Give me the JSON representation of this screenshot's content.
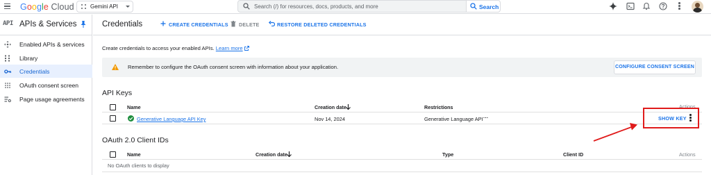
{
  "topbar": {
    "logo_parts": [
      "G",
      "o",
      "o",
      "g",
      "l",
      "e"
    ],
    "logo_cloud": "Cloud",
    "project": "Gemini API",
    "search_placeholder": "Search (/) for resources, docs, products, and more",
    "search_button": "Search",
    "icons": [
      "gemini-spark-icon",
      "cloud-shell-icon",
      "notifications-icon",
      "help-icon",
      "more-vert-icon"
    ]
  },
  "sidebar": {
    "api_badge": "API",
    "title": "APIs & Services",
    "items": [
      {
        "label": "Enabled APIs & services",
        "icon": "move-icon"
      },
      {
        "label": "Library",
        "icon": "grid-icon"
      },
      {
        "label": "Credentials",
        "icon": "key-icon",
        "active": true
      },
      {
        "label": "OAuth consent screen",
        "icon": "consent-dots-icon"
      },
      {
        "label": "Page usage agreements",
        "icon": "settings-list-icon"
      }
    ]
  },
  "header": {
    "title": "Credentials",
    "actions": {
      "create": "CREATE CREDENTIALS",
      "delete": "DELETE",
      "restore": "RESTORE DELETED CREDENTIALS"
    }
  },
  "intro": {
    "text": "Create credentials to access your enabled APIs.",
    "link": "Learn more"
  },
  "banner": {
    "message": "Remember to configure the OAuth consent screen with information about your application.",
    "button": "CONFIGURE CONSENT SCREEN"
  },
  "api_keys": {
    "title": "API Keys",
    "columns": {
      "name": "Name",
      "created": "Creation date",
      "restrictions": "Restrictions",
      "actions": "Actions"
    },
    "rows": [
      {
        "name": "Generative Language API Key",
        "created": "Nov 14, 2024",
        "restrictions": "Generative Language API",
        "more": "···",
        "show_key": "SHOW KEY"
      }
    ]
  },
  "oauth": {
    "title": "OAuth 2.0 Client IDs",
    "columns": {
      "name": "Name",
      "created": "Creation date",
      "type": "Type",
      "client_id": "Client ID",
      "actions": "Actions"
    },
    "empty": "No OAuth clients to display"
  },
  "colors": {
    "accent": "#1a73e8",
    "annotation": "#e01b1b",
    "active_bg": "#e8f0fe",
    "ok": "#1e8e3e",
    "warn": "#f29900"
  }
}
